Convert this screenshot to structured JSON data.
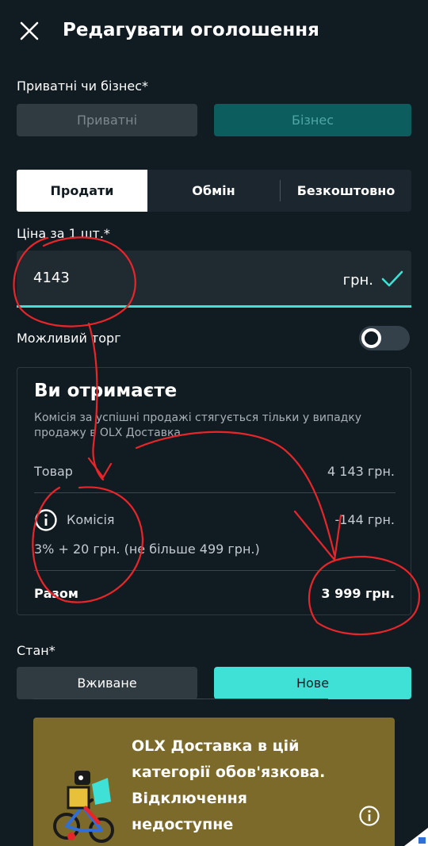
{
  "header": {
    "title": "Редагувати оголошення",
    "close_icon": "close-icon"
  },
  "seller_type": {
    "label": "Приватні чи бізнес*",
    "options": [
      "Приватні",
      "Бізнес"
    ],
    "selected": "Бізнес"
  },
  "deal_tabs": {
    "items": [
      "Продати",
      "Обмін",
      "Безкоштовно"
    ],
    "active": "Продати"
  },
  "price": {
    "label": "Ціна за 1 шт.*",
    "value": "4143",
    "unit": "грн."
  },
  "negotiable": {
    "label": "Можливий торг",
    "enabled": false
  },
  "earnings": {
    "title": "Ви отримаєте",
    "description": "Комісія за успішні продажі стягується тільки у випадку продажу в OLX Доставка",
    "item_label": "Товар",
    "item_value": "4 143 грн.",
    "commission_label": "Комісія",
    "commission_value": "-144 грн.",
    "commission_note": "3% + 20 грн. (не більше 499 грн.)",
    "total_label": "Разом",
    "total_value": "3 999 грн."
  },
  "condition": {
    "label": "Стан*",
    "options": [
      "Вживане",
      "Нове"
    ],
    "selected": "Нове"
  },
  "delivery_banner": {
    "text": "OLX Доставка в цій категорії обов'язкова. Відключення недоступне"
  },
  "colors": {
    "background": "#111b22",
    "accent_teal": "#3fe0d5",
    "dark_teal": "#0c5d5e",
    "banner": "#7b6a2a",
    "annotation_red": "#e8262a"
  }
}
